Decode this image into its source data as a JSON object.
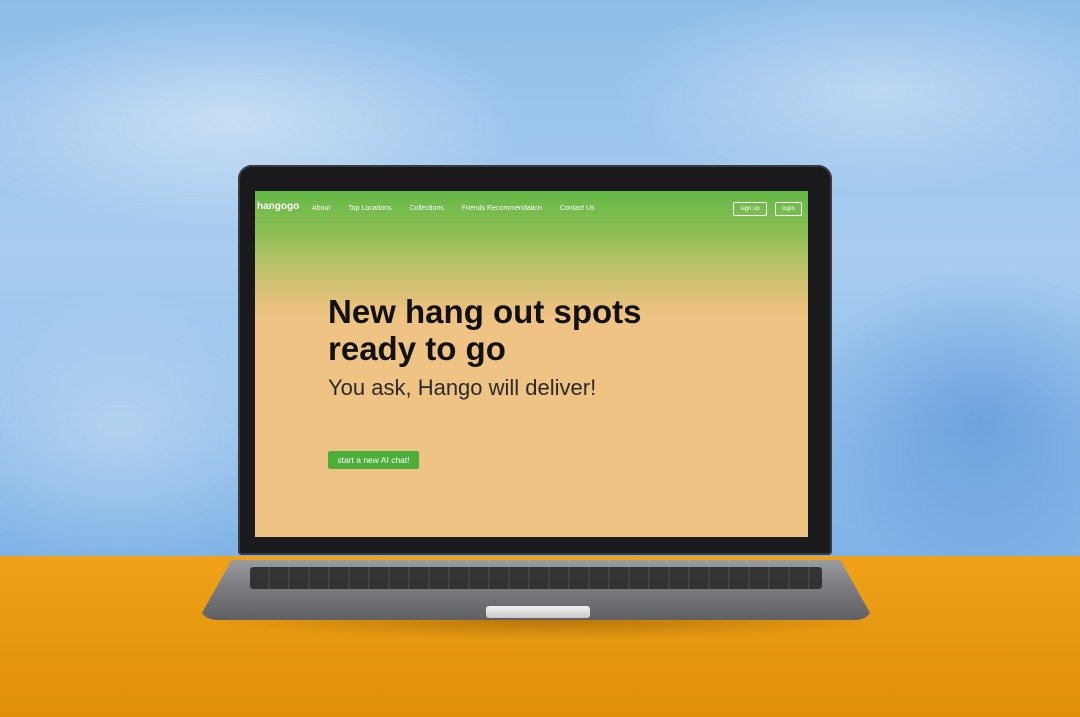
{
  "site": {
    "brand": "hangogo",
    "nav_links": [
      "About",
      "Top Locations",
      "Collections",
      "Friends Recommendation",
      "Contact Us"
    ],
    "signup_label": "sign up",
    "login_label": "login"
  },
  "hero": {
    "title": "New hang out spots ready to go",
    "subtitle": "You ask, Hango will deliver!",
    "cta_label": "start a new AI chat!"
  },
  "colors": {
    "nav_green": "#63b947",
    "page_background": "#efc383",
    "cta_green": "#4caf3a",
    "sky_blue": "#8fbde9",
    "table_orange": "#e89a12"
  }
}
